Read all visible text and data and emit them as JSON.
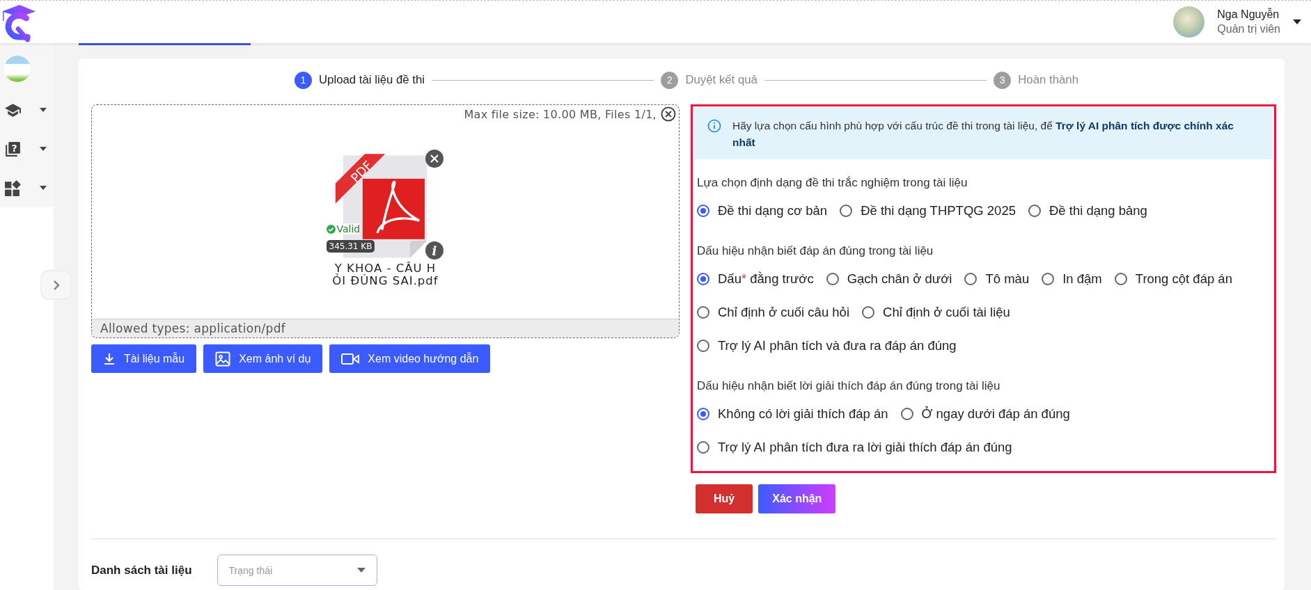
{
  "header": {
    "user": {
      "name": "Nga Nguyễn",
      "role": "Quản trị viên"
    }
  },
  "sidebar": {
    "help_glyph": "?"
  },
  "stepper": [
    {
      "number": "1",
      "label": "Upload tài liệu đề thi",
      "selected": true
    },
    {
      "number": "2",
      "label": "Duyệt kết quả",
      "selected": false
    },
    {
      "number": "3",
      "label": "Hoàn thành",
      "selected": false
    }
  ],
  "upload": {
    "info": "Max file size: 10.00 MB, Files 1/1,",
    "file": {
      "type": "PDF",
      "info_glyph": "i",
      "status": "Valid",
      "size": "345.31 KB",
      "name": "Y KHOA - CÂU H\nỎI ĐÚNG SAI.pdf"
    },
    "allowed": "Allowed types: application/pdf"
  },
  "actions": [
    {
      "label": "Tài liệu mẫu",
      "kind": "download"
    },
    {
      "label": "Xem ảnh ví dụ",
      "kind": "image"
    },
    {
      "label": "Xem video hướng dẫn",
      "kind": "video"
    }
  ],
  "config": {
    "notice": "Hãy lựa chọn cấu hình phù hợp với cấu trúc đề thi trong tài liệu, để **Trợ lý AI phân tích được chính xác nhất**",
    "groups": [
      {
        "title": "Lựa chọn định dạng đề thi trắc nghiệm trong tài liệu",
        "rows": [
          [
            {
              "label": "Đề thi dạng cơ bản",
              "selected": true
            },
            {
              "label": "Đề thi dạng THPTQG 2025",
              "selected": false
            },
            {
              "label": "Đề thi dạng bảng",
              "selected": false
            }
          ]
        ]
      },
      {
        "title": "Dấu hiệu nhận biết đáp án đúng trong tài liệu",
        "rows": [
          [
            {
              "label": "Dấu",
              "marker": "*",
              "label_after": "đằng trước",
              "selected": true
            },
            {
              "label": "Gạch chân ở dưới",
              "selected": false
            },
            {
              "label": "Tô màu",
              "selected": false
            },
            {
              "label": "In đậm",
              "selected": false
            },
            {
              "label": "Trong cột đáp án",
              "selected": false
            }
          ],
          [
            {
              "label": "Chỉ định ở cuối câu hỏi",
              "selected": false
            },
            {
              "label": "Chỉ định ở cuối tài liệu",
              "selected": false
            }
          ],
          [
            {
              "label": "Trợ lý AI phân tích và đưa ra đáp án đúng",
              "selected": false
            }
          ]
        ]
      },
      {
        "title": "Dấu hiệu nhận biết lời giải thích đáp án đúng trong tài liệu",
        "rows": [
          [
            {
              "label": "Không có lời giải thích đáp án",
              "selected": true
            },
            {
              "label": "Ở ngay dưới đáp án đúng",
              "selected": false
            }
          ],
          [
            {
              "label": "Trợ lý AI phân tích đưa ra lời giải thích đáp án đúng",
              "selected": false
            }
          ]
        ]
      }
    ]
  },
  "buttons": [
    {
      "label": "Huỷ",
      "kind": "cancel"
    },
    {
      "label": "Xác nhận",
      "kind": "confirm"
    }
  ],
  "list": {
    "title": "Danh sách tài liệu",
    "filter": {
      "placeholder": "Trạng thái"
    }
  }
}
